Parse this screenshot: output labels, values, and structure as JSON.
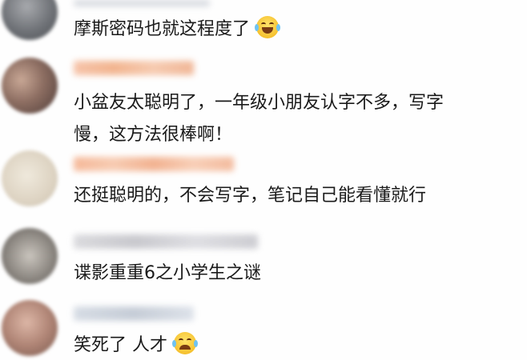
{
  "comments": [
    {
      "text": "摩斯密码也就这程度了",
      "emoji": "laughing-with-tears-icon"
    },
    {
      "text_line1": "小盆友太聪明了，一年级小朋友认字不多，写字",
      "text_line2": "慢，这方法很棒啊！"
    },
    {
      "text": "还挺聪明的，不会写字，笔记自己能看懂就行"
    },
    {
      "text": "谍影重重6之小学生之谜"
    },
    {
      "text": "笑死了 人才",
      "emoji": "crying-laughing-icon"
    }
  ],
  "colors": {
    "text": "#1a1a1a",
    "name_blur_orange": "#f3b184",
    "name_blur_gray": "#c9c9c9"
  }
}
